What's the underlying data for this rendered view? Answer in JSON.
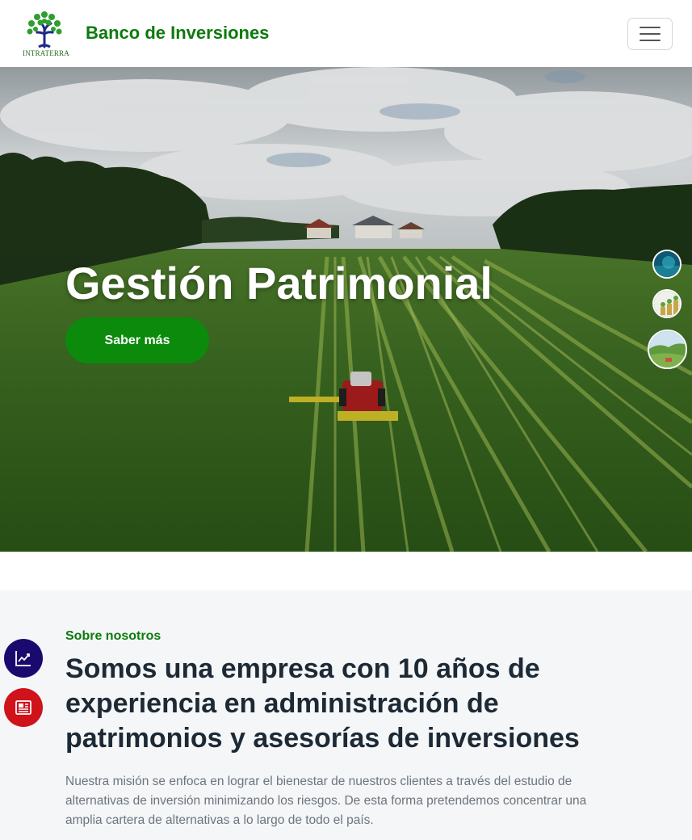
{
  "header": {
    "logo_text": "INTRATERRA",
    "brand": "Banco de Inversiones",
    "menu_icon": "hamburger-menu-icon"
  },
  "hero": {
    "title": "Gestión Patrimonial",
    "cta_label": "Saber más",
    "thumbnails": [
      "ocean-thumbnail",
      "coins-plant-thumbnail",
      "landscape-thumbnail"
    ]
  },
  "about": {
    "eyebrow": "Sobre nosotros",
    "title": "Somos una empresa con 10 años de experiencia en administración de patrimonios y asesorías de inversiones",
    "text": "Nuestra misión se enfoca en lograr el bienestar de nuestros clientes a través del estudio de alternativas de inversión minimizando los riesgos. De esta forma pretendemos concentrar una amplia cartera de alternativas a lo largo de todo el país."
  },
  "floating": {
    "chart_button_icon": "line-chart-icon",
    "news_button_icon": "newspaper-icon"
  },
  "colors": {
    "brand_green": "#0d7a0d",
    "button_green": "#0b8a0b",
    "chart_button": "#1a0a6e",
    "news_button": "#d0121b",
    "section_bg": "#f4f6f8"
  }
}
